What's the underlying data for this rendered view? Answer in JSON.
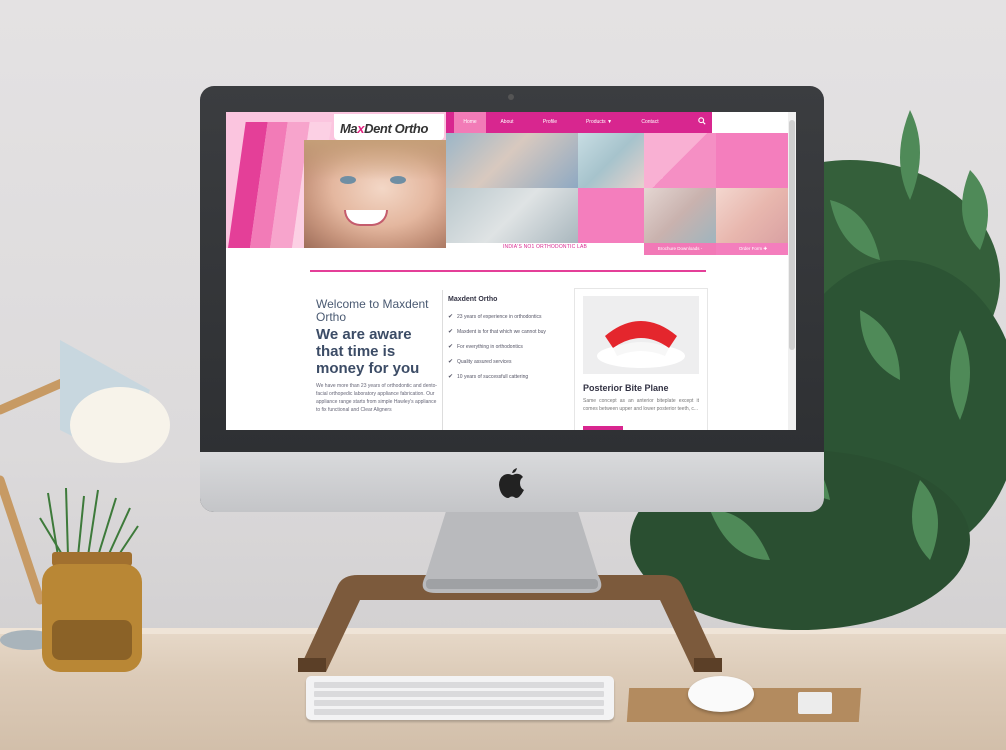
{
  "brand": {
    "logo_prefix": "Ma",
    "logo_x": "x",
    "logo_suffix": "Dent Ortho"
  },
  "nav": {
    "items": [
      {
        "label": "Home",
        "active": true
      },
      {
        "label": "About",
        "active": false
      },
      {
        "label": "Profile",
        "active": false
      },
      {
        "label": "Products ▼",
        "active": false
      },
      {
        "label": "Contact",
        "active": false
      }
    ]
  },
  "header": {
    "tagline": "INDIA'S NO1 ORTHODONTIC LAB",
    "brochure_label": "Brochure Downloads -",
    "order_label": "Order Form ✚"
  },
  "intro": {
    "welcome": "Welcome to Maxdent Ortho",
    "headline": "We are aware that time is money for you",
    "paragraph": "We have more than 23 years of orthodontic and dento-facial orthopedic laboratory appliance fabrication. Our appliance range starts from simple Hawley's appliance to fix functional and Clear Aligners"
  },
  "features": {
    "title": "Maxdent Ortho",
    "items": [
      "23 years of experience in orthodontics",
      "Maxdent is for that which we cannot buy",
      "For everything in orthodontics",
      "Quality assured services",
      "10 years of successfull cattering"
    ]
  },
  "product_card": {
    "title": "Posterior Bite Plane",
    "text": "Same concept as an anterior biteplate except it comes between upper and lower posterior teeth, c..."
  },
  "colors": {
    "brand_pink": "#d8268f",
    "light_pink": "#fbc5df",
    "accent_pink": "#f47ebd",
    "text_dark": "#3c4c66"
  }
}
